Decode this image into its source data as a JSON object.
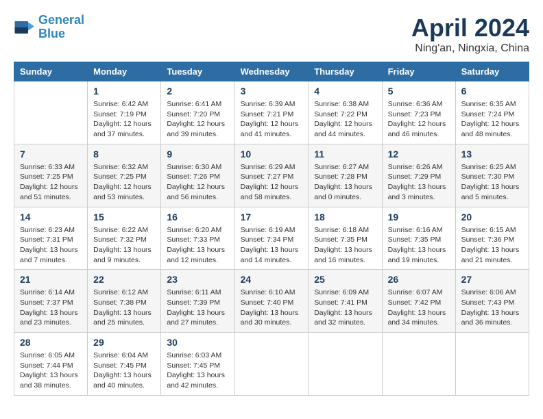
{
  "logo": {
    "line1": "General",
    "line2": "Blue"
  },
  "title": "April 2024",
  "subtitle": "Ning'an, Ningxia, China",
  "headers": [
    "Sunday",
    "Monday",
    "Tuesday",
    "Wednesday",
    "Thursday",
    "Friday",
    "Saturday"
  ],
  "weeks": [
    [
      {
        "day": "",
        "info": ""
      },
      {
        "day": "1",
        "info": "Sunrise: 6:42 AM\nSunset: 7:19 PM\nDaylight: 12 hours\nand 37 minutes."
      },
      {
        "day": "2",
        "info": "Sunrise: 6:41 AM\nSunset: 7:20 PM\nDaylight: 12 hours\nand 39 minutes."
      },
      {
        "day": "3",
        "info": "Sunrise: 6:39 AM\nSunset: 7:21 PM\nDaylight: 12 hours\nand 41 minutes."
      },
      {
        "day": "4",
        "info": "Sunrise: 6:38 AM\nSunset: 7:22 PM\nDaylight: 12 hours\nand 44 minutes."
      },
      {
        "day": "5",
        "info": "Sunrise: 6:36 AM\nSunset: 7:23 PM\nDaylight: 12 hours\nand 46 minutes."
      },
      {
        "day": "6",
        "info": "Sunrise: 6:35 AM\nSunset: 7:24 PM\nDaylight: 12 hours\nand 48 minutes."
      }
    ],
    [
      {
        "day": "7",
        "info": "Sunrise: 6:33 AM\nSunset: 7:25 PM\nDaylight: 12 hours\nand 51 minutes."
      },
      {
        "day": "8",
        "info": "Sunrise: 6:32 AM\nSunset: 7:25 PM\nDaylight: 12 hours\nand 53 minutes."
      },
      {
        "day": "9",
        "info": "Sunrise: 6:30 AM\nSunset: 7:26 PM\nDaylight: 12 hours\nand 56 minutes."
      },
      {
        "day": "10",
        "info": "Sunrise: 6:29 AM\nSunset: 7:27 PM\nDaylight: 12 hours\nand 58 minutes."
      },
      {
        "day": "11",
        "info": "Sunrise: 6:27 AM\nSunset: 7:28 PM\nDaylight: 13 hours\nand 0 minutes."
      },
      {
        "day": "12",
        "info": "Sunrise: 6:26 AM\nSunset: 7:29 PM\nDaylight: 13 hours\nand 3 minutes."
      },
      {
        "day": "13",
        "info": "Sunrise: 6:25 AM\nSunset: 7:30 PM\nDaylight: 13 hours\nand 5 minutes."
      }
    ],
    [
      {
        "day": "14",
        "info": "Sunrise: 6:23 AM\nSunset: 7:31 PM\nDaylight: 13 hours\nand 7 minutes."
      },
      {
        "day": "15",
        "info": "Sunrise: 6:22 AM\nSunset: 7:32 PM\nDaylight: 13 hours\nand 9 minutes."
      },
      {
        "day": "16",
        "info": "Sunrise: 6:20 AM\nSunset: 7:33 PM\nDaylight: 13 hours\nand 12 minutes."
      },
      {
        "day": "17",
        "info": "Sunrise: 6:19 AM\nSunset: 7:34 PM\nDaylight: 13 hours\nand 14 minutes."
      },
      {
        "day": "18",
        "info": "Sunrise: 6:18 AM\nSunset: 7:35 PM\nDaylight: 13 hours\nand 16 minutes."
      },
      {
        "day": "19",
        "info": "Sunrise: 6:16 AM\nSunset: 7:35 PM\nDaylight: 13 hours\nand 19 minutes."
      },
      {
        "day": "20",
        "info": "Sunrise: 6:15 AM\nSunset: 7:36 PM\nDaylight: 13 hours\nand 21 minutes."
      }
    ],
    [
      {
        "day": "21",
        "info": "Sunrise: 6:14 AM\nSunset: 7:37 PM\nDaylight: 13 hours\nand 23 minutes."
      },
      {
        "day": "22",
        "info": "Sunrise: 6:12 AM\nSunset: 7:38 PM\nDaylight: 13 hours\nand 25 minutes."
      },
      {
        "day": "23",
        "info": "Sunrise: 6:11 AM\nSunset: 7:39 PM\nDaylight: 13 hours\nand 27 minutes."
      },
      {
        "day": "24",
        "info": "Sunrise: 6:10 AM\nSunset: 7:40 PM\nDaylight: 13 hours\nand 30 minutes."
      },
      {
        "day": "25",
        "info": "Sunrise: 6:09 AM\nSunset: 7:41 PM\nDaylight: 13 hours\nand 32 minutes."
      },
      {
        "day": "26",
        "info": "Sunrise: 6:07 AM\nSunset: 7:42 PM\nDaylight: 13 hours\nand 34 minutes."
      },
      {
        "day": "27",
        "info": "Sunrise: 6:06 AM\nSunset: 7:43 PM\nDaylight: 13 hours\nand 36 minutes."
      }
    ],
    [
      {
        "day": "28",
        "info": "Sunrise: 6:05 AM\nSunset: 7:44 PM\nDaylight: 13 hours\nand 38 minutes."
      },
      {
        "day": "29",
        "info": "Sunrise: 6:04 AM\nSunset: 7:45 PM\nDaylight: 13 hours\nand 40 minutes."
      },
      {
        "day": "30",
        "info": "Sunrise: 6:03 AM\nSunset: 7:45 PM\nDaylight: 13 hours\nand 42 minutes."
      },
      {
        "day": "",
        "info": ""
      },
      {
        "day": "",
        "info": ""
      },
      {
        "day": "",
        "info": ""
      },
      {
        "day": "",
        "info": ""
      }
    ]
  ]
}
